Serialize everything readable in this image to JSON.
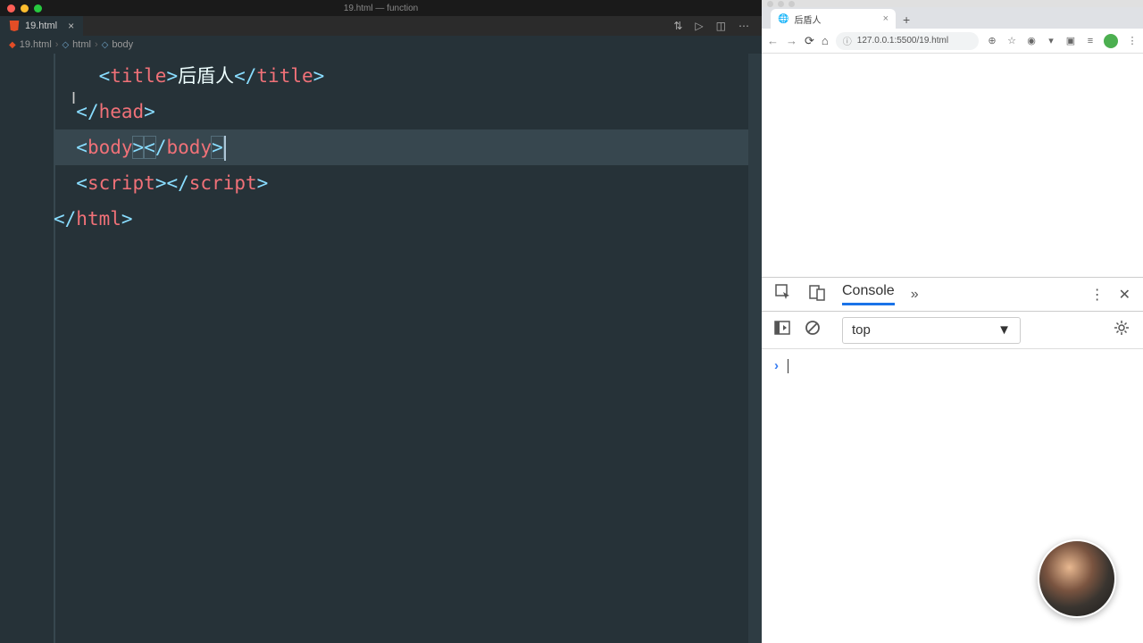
{
  "vscode": {
    "titlebar": "19.html — function",
    "tab_name": "19.html",
    "breadcrumb": {
      "file": "19.html",
      "tag1": "html",
      "tag2": "body"
    },
    "code": {
      "title_open": "title",
      "title_text": "后盾人",
      "title_close": "title",
      "head_close": "head",
      "body_open": "body",
      "body_close": "body",
      "script_open": "script",
      "script_close": "script",
      "html_close": "html"
    }
  },
  "chrome": {
    "tab_title": "后盾人",
    "url": "127.0.0.1:5500/19.html"
  },
  "devtools": {
    "tab_console": "Console",
    "context": "top"
  }
}
